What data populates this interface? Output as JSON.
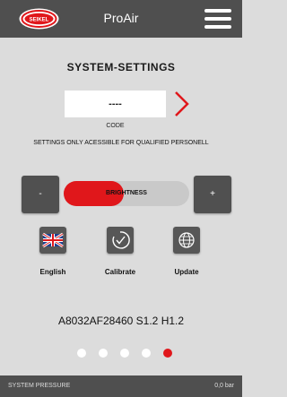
{
  "header": {
    "logo_text": "SEIKEL",
    "app_title": "ProAir",
    "menu_icon": "hamburger-menu-icon"
  },
  "page": {
    "title": "SYSTEM-SETTINGS"
  },
  "code": {
    "value": "----",
    "label": "CODE"
  },
  "warning": "SETTINGS ONLY ACESSIBLE FOR QUALIFIED PERSONELL",
  "brightness": {
    "minus_label": "-",
    "plus_label": "+",
    "label": "BRIGHTNESS",
    "level": 0.48
  },
  "actions": [
    {
      "label": "English",
      "icon": "uk-flag-icon"
    },
    {
      "label": "Calibrate",
      "icon": "calibrate-icon"
    },
    {
      "label": "Update",
      "icon": "globe-icon"
    }
  ],
  "version": "A8032AF28460 S1.2 H1.2",
  "pagination": {
    "count": 5,
    "active_index": 4
  },
  "footer": {
    "label": "SYSTEM PRESSURE",
    "value": "0,0 bar"
  },
  "colors": {
    "accent": "#e0171b",
    "bar": "#4f4f4f",
    "background": "#dcdcdc"
  }
}
